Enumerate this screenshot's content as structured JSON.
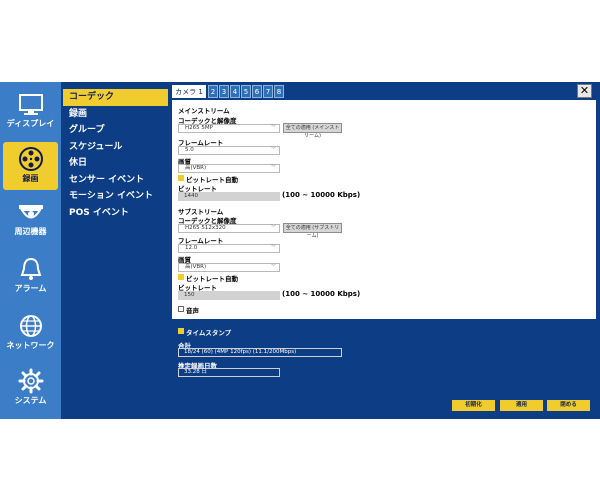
{
  "nav": {
    "items": [
      {
        "label": "ディスプレイ",
        "icon": "monitor-icon",
        "active": false
      },
      {
        "label": "録画",
        "icon": "film-reel-icon",
        "active": true
      },
      {
        "label": "周辺機器",
        "icon": "dome-camera-icon",
        "active": false
      },
      {
        "label": "アラーム",
        "icon": "bell-icon",
        "active": false
      },
      {
        "label": "ネットワーク",
        "icon": "globe-icon",
        "active": false
      },
      {
        "label": "システム",
        "icon": "gear-icon",
        "active": false
      }
    ]
  },
  "submenu": {
    "items": [
      "コーデック",
      "録画",
      "グループ",
      "スケジュール",
      "休日",
      "センサー イベント",
      "モーション イベント",
      "POS イベント"
    ],
    "active_index": 0
  },
  "tabs": {
    "items": [
      "カメラ 1",
      "2",
      "3",
      "4",
      "5",
      "6",
      "7",
      "8"
    ],
    "active_index": 0,
    "close_label": "✕"
  },
  "mainstream": {
    "heading": "メインストリーム",
    "codec_label": "コーデックと解像度",
    "codec_value": "H265 5MP",
    "apply_all_label": "全ての適用 (メインストリーム)",
    "framerate_label": "フレームレート",
    "framerate_value": "5.0",
    "quality_label": "画質",
    "quality_value": "高(VBR)",
    "bitrate_auto_label": "ビットレート自動",
    "bitrate_label": "ビットレート",
    "bitrate_value": "1440",
    "bitrate_range": "(100 ~ 10000 Kbps)"
  },
  "substream": {
    "heading": "サブストリーム",
    "codec_label": "コーデックと解像度",
    "codec_value": "H265 512x320",
    "apply_all_label": "全ての適用 (サブストリーム)",
    "framerate_label": "フレームレート",
    "framerate_value": "12.0",
    "quality_label": "画質",
    "quality_value": "高(VBR)",
    "bitrate_auto_label": "ビットレート自動",
    "bitrate_label": "ビットレート",
    "bitrate_value": "150",
    "bitrate_range": "(100 ~ 10000 Kbps)"
  },
  "audio": {
    "label": "音声",
    "checked": false
  },
  "status": {
    "timestamp_label": "タイムスタンプ",
    "total_label": "合計",
    "total_value": "18/24 (60) (4MP 120fps)  (11.1/200Mbps)",
    "estimate_label": "推定録画日数",
    "estimate_value": "33.28 日"
  },
  "actions": {
    "reset_label": "初期化",
    "apply_label": "適用",
    "close_label": "閉める"
  },
  "colors": {
    "background": "#0d3e85",
    "nav": "#3c7dc8",
    "accent": "#f0cc2e"
  }
}
